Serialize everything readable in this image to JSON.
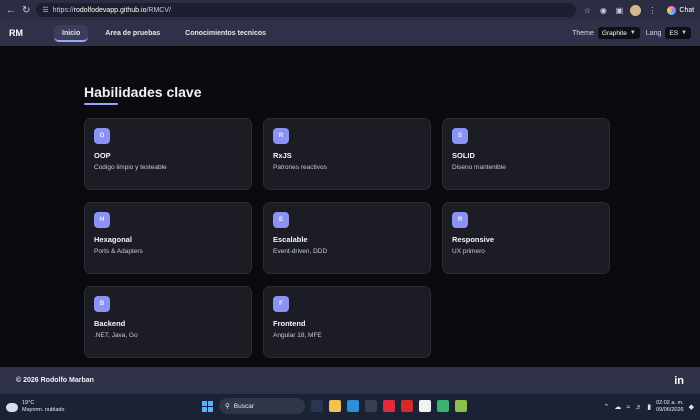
{
  "browser": {
    "url_scheme": "https://",
    "url_host": "rodolfodevapp.github.io",
    "url_path": "/RMCV/",
    "chat_label": "Chat"
  },
  "header": {
    "logo": "RM",
    "tabs": [
      {
        "label": "Inicio",
        "active": true
      },
      {
        "label": "Area de pruebas",
        "active": false
      },
      {
        "label": "Conocimientos tecnicos",
        "active": false
      }
    ],
    "theme_label": "Theme",
    "theme_value": "Graphite",
    "lang_label": "Lang",
    "lang_value": "ES"
  },
  "section": {
    "title": "Habilidades clave",
    "cards": [
      {
        "badge": "O",
        "title": "OOP",
        "desc": "Codigo limpio y testeable"
      },
      {
        "badge": "R",
        "title": "RxJS",
        "desc": "Patrones reactivos"
      },
      {
        "badge": "S",
        "title": "SOLID",
        "desc": "Diseno mantenible"
      },
      {
        "badge": "H",
        "title": "Hexagonal",
        "desc": "Ports & Adapters"
      },
      {
        "badge": "E",
        "title": "Escalable",
        "desc": "Event-driven, DDD"
      },
      {
        "badge": "R",
        "title": "Responsive",
        "desc": "UX primero"
      },
      {
        "badge": "B",
        "title": "Backend",
        "desc": ".NET, Java, Go"
      },
      {
        "badge": "F",
        "title": "Frontend",
        "desc": "Angular 18, MFE"
      }
    ]
  },
  "footer": {
    "copyright": "© 2026 Rodolfo Marban",
    "social": "in"
  },
  "taskbar": {
    "temperature": "19°C",
    "weather_desc": "Mayorm. nublado",
    "search_placeholder": "Buscar",
    "time": "02:02 a. m.",
    "date": "09/06/2026"
  },
  "colors": {
    "accent": "#9aa4ff",
    "badge": "#8a93f5",
    "card_bg": "#1b1c24",
    "header_bg": "#2e3147",
    "page_bg": "#0b0b0f"
  }
}
